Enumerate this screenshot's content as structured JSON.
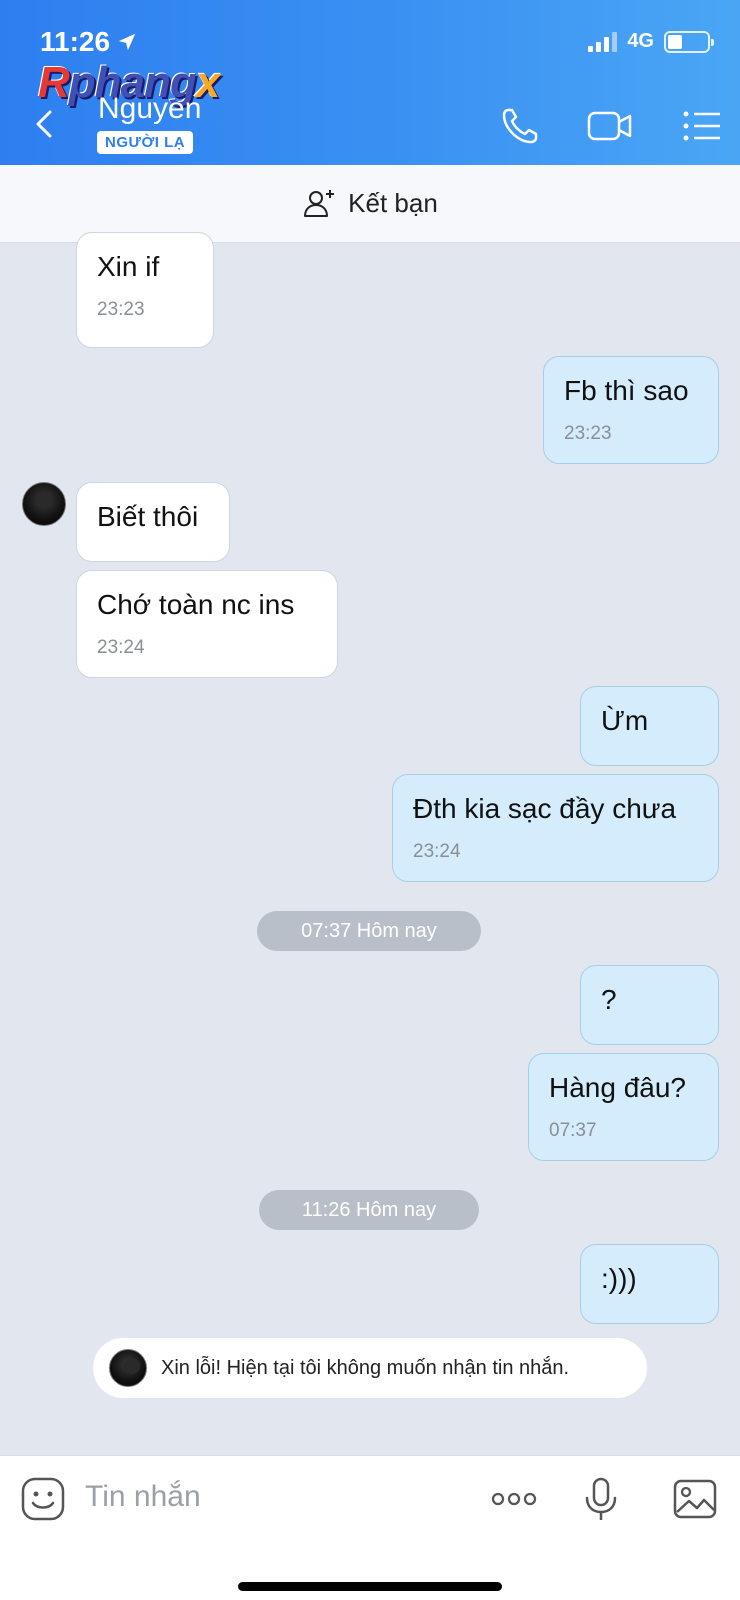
{
  "status": {
    "time": "11:26",
    "network": "4G"
  },
  "watermark": {
    "part1": "R",
    "part2": "phang",
    "part3": "x"
  },
  "header": {
    "contact_name": "Nguyen",
    "badge": "NGƯỜI LẠ"
  },
  "friend_bar": {
    "label": "Kết bạn"
  },
  "messages": [
    {
      "text": "Xin if",
      "time": "23:23"
    },
    {
      "text": "Fb thì sao",
      "time": "23:23"
    },
    {
      "text": "Biết thôi"
    },
    {
      "text": "Chớ toàn nc ins",
      "time": "23:24"
    },
    {
      "text": "Ừm"
    },
    {
      "text": "Đth kia sạc đầy chưa",
      "time": "23:24"
    },
    {
      "text": "?"
    },
    {
      "text": "Hàng đâu?",
      "time": "07:37"
    },
    {
      "text": ":)))"
    }
  ],
  "dividers": [
    "07:37 Hôm nay",
    "11:26 Hôm nay"
  ],
  "auto_reply": {
    "text": "Xin lỗi! Hiện tại tôi không muốn nhận tin nhắn."
  },
  "composer": {
    "placeholder": "Tin nhắn"
  },
  "colors": {
    "header_start": "#2d7ff0",
    "header_end": "#4aa6f5",
    "outgoing_bubble": "#d4ecfb",
    "incoming_bubble": "#ffffff",
    "chat_bg": "#e2e7ef"
  }
}
